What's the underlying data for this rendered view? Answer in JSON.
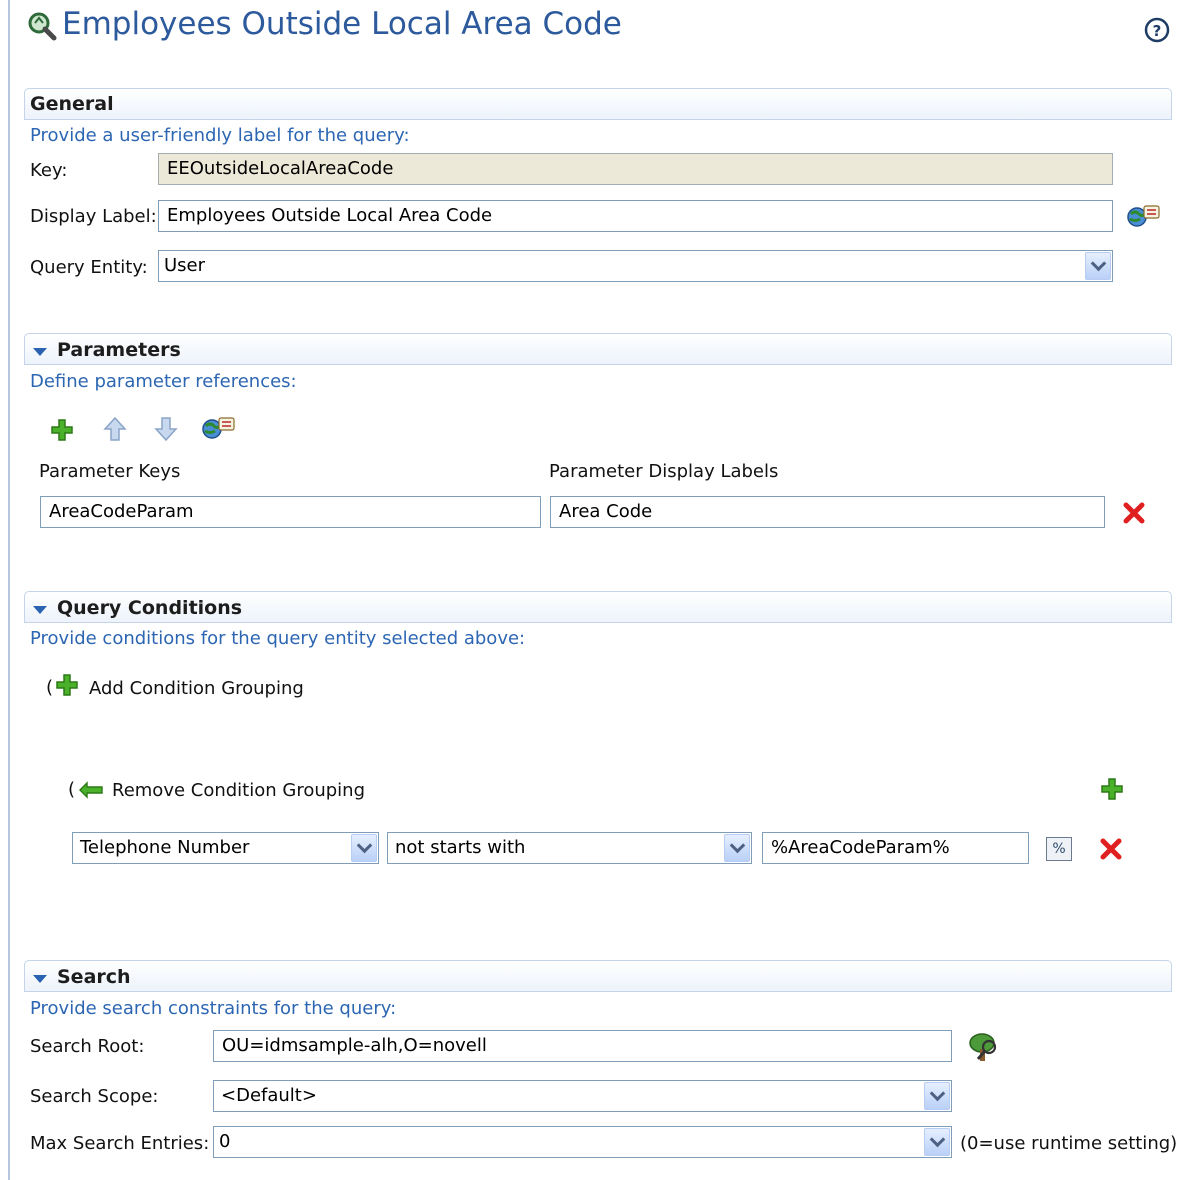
{
  "title": "Employees Outside Local Area Code",
  "general": {
    "title": "General",
    "hint": "Provide a user-friendly label for the query:",
    "key_label": "Key:",
    "key_value": "EEOutsideLocalAreaCode",
    "display_label": "Display Label:",
    "display_value": "Employees Outside Local Area Code",
    "entity_label": "Query Entity:",
    "entity_value": "User"
  },
  "parameters": {
    "title": "Parameters",
    "hint": "Define parameter references:",
    "keys_header": "Parameter Keys",
    "labels_header": "Parameter Display Labels",
    "rows": [
      {
        "key": "AreaCodeParam",
        "label": "Area Code"
      }
    ]
  },
  "conditions": {
    "title": "Query Conditions",
    "hint": "Provide conditions for the query entity selected above:",
    "add_grouping": "Add Condition Grouping",
    "remove_grouping": "Remove Condition Grouping",
    "paren": "(",
    "row": {
      "attribute": "Telephone Number",
      "operator": "not starts with",
      "value": "%AreaCodeParam%",
      "param_button": "%"
    }
  },
  "search": {
    "title": "Search",
    "hint": "Provide search constraints for the query:",
    "root_label": "Search Root:",
    "root_value": "OU=idmsample-alh,O=novell",
    "scope_label": "Search Scope:",
    "scope_value": "<Default>",
    "max_label": "Max Search Entries:",
    "max_value": "0",
    "max_note": "(0=use runtime setting)"
  },
  "colors": {
    "title": "#2c5a9c",
    "hint": "#2c66b3",
    "add": "#3c9a1e",
    "delete": "#e02020"
  }
}
